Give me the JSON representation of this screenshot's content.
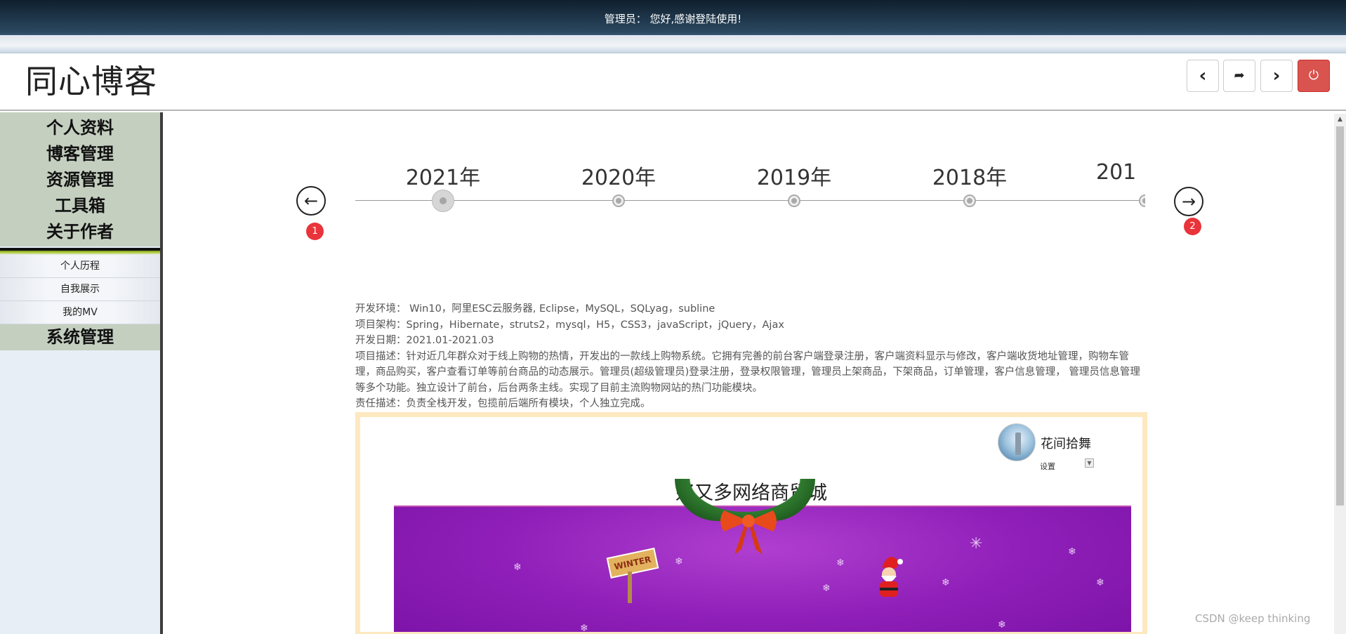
{
  "topbar": {
    "greeting": "管理员： 您好,感谢登陆使用!"
  },
  "header": {
    "site_title": "同心博客",
    "buttons": [
      {
        "name": "back-button",
        "icon": "chevron-left-icon",
        "glyph": "‹"
      },
      {
        "name": "share-button",
        "icon": "share-arrow-icon",
        "glyph": "➦"
      },
      {
        "name": "forward-button",
        "icon": "chevron-right-icon",
        "glyph": "›"
      },
      {
        "name": "logout-button",
        "icon": "power-icon",
        "glyph": "⏻"
      }
    ]
  },
  "sidebar": {
    "main_items": [
      "个人资料",
      "博客管理",
      "资源管理",
      "工具箱",
      "关于作者"
    ],
    "sub_items": [
      "个人历程",
      "自我展示",
      "我的MV"
    ],
    "last_item": "系统管理"
  },
  "timeline": {
    "years": [
      "2021年",
      "2020年",
      "2019年",
      "2018年",
      "201"
    ],
    "active_index": 0,
    "prev_badge": "1",
    "next_badge": "2"
  },
  "project": {
    "lines": [
      "开发环境： Win10，阿里ESC云服务器, Eclipse，MySQL，SQLyag，subline",
      "项目架构：Spring，Hibernate，struts2，mysql，H5，CSS3，javaScript，jQuery，Ajax",
      "开发日期：2021.01-2021.03",
      "项目描述：针对近几年群众对于线上购物的热情，开发出的一款线上购物系统。它拥有完善的前台客户端登录注册，客户端资料显示与修改，客户端收货地址管理，购物车管理，商品购买，客户查看订单等前台商品的动态展示。管理员(超级管理员)登录注册，登录权限管理，管理员上架商品，下架商品，订单管理，客户信息管理， 管理员信息管理等多个功能。独立设计了前台，后台两条主线。实现了目前主流购物网站的热门功能模块。",
      "责任描述：负责全栈开发，包揽前后端所有模块，个人独立完成。"
    ]
  },
  "preview": {
    "username": "花间拾舞",
    "settings_label": "设置",
    "shop_title": "好又多网络商贸城",
    "sign_text": "WINTER"
  },
  "watermark": "CSDN @keep   thinking",
  "colors": {
    "topbar": "#1c3347",
    "sidebar_menu": "#c4cfc0",
    "power_button": "#d9534f",
    "badge": "#e8343a",
    "banner": "#8f1fb8"
  }
}
